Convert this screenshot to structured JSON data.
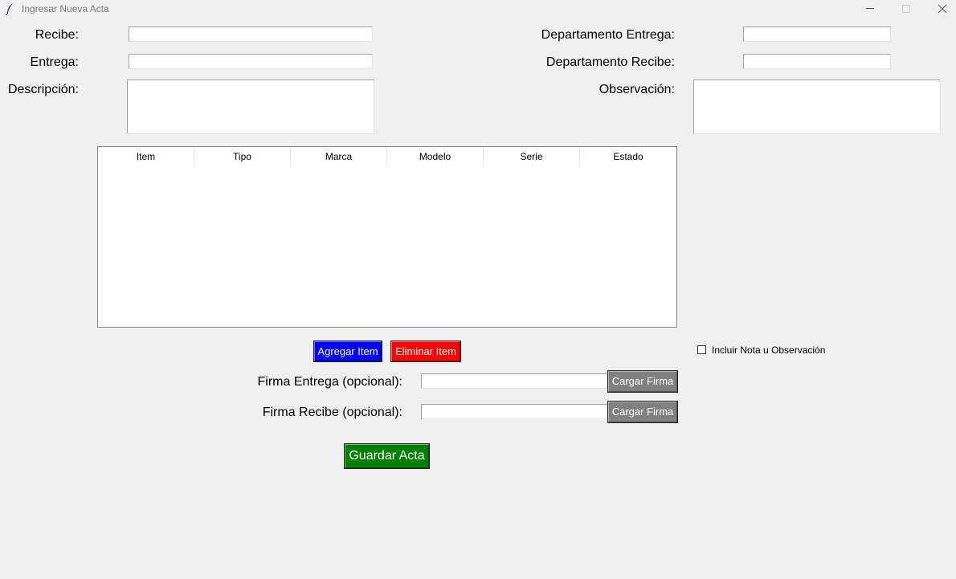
{
  "window": {
    "title": "Ingresar Nueva Acta",
    "minimize_icon": "minimize-icon",
    "maximize_icon": "maximize-icon",
    "close_icon": "close-icon"
  },
  "form": {
    "recibe_label": "Recibe:",
    "recibe_value": "",
    "entrega_label": "Entrega:",
    "entrega_value": "",
    "descripcion_label": "Descripción:",
    "descripcion_value": "",
    "depto_entrega_label": "Departamento Entrega:",
    "depto_entrega_value": "",
    "depto_recibe_label": "Departamento Recibe:",
    "depto_recibe_value": "",
    "observacion_label": "Observación:",
    "observacion_value": ""
  },
  "table": {
    "columns": [
      "Item",
      "Tipo",
      "Marca",
      "Modelo",
      "Serie",
      "Estado"
    ],
    "rows": []
  },
  "buttons": {
    "agregar": "Agregar Item",
    "eliminar": "Eliminar Item",
    "cargar_firma_entrega": "Cargar Firma",
    "cargar_firma_recibe": "Cargar Firma",
    "guardar": "Guardar Acta"
  },
  "firmas": {
    "entrega_label": "Firma Entrega (opcional):",
    "entrega_value": "",
    "recibe_label": "Firma Recibe (opcional):",
    "recibe_value": ""
  },
  "options": {
    "incluir_nota_label": "Incluir Nota u Observación",
    "incluir_nota_checked": false
  },
  "colors": {
    "agregar": "#0000ff",
    "eliminar": "#ff0000",
    "cargar": "#808080",
    "guardar": "#008000"
  }
}
